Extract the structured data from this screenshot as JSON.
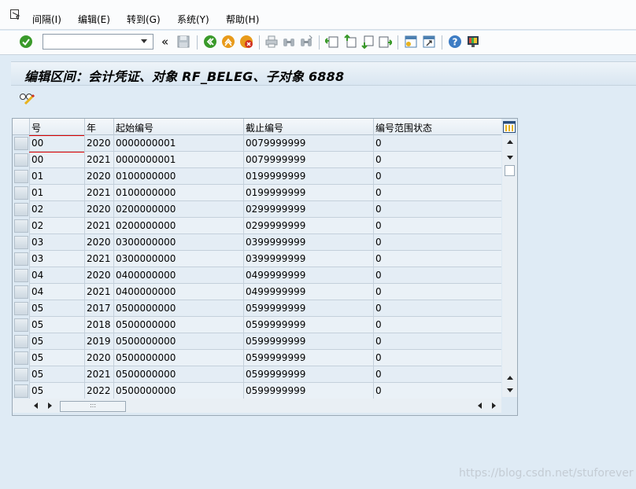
{
  "menu": {
    "items": [
      "间隔(I)",
      "编辑(E)",
      "转到(G)",
      "系统(Y)",
      "帮助(H)"
    ]
  },
  "toolbar": {
    "command_value": "",
    "icons": [
      "enter-check-icon",
      "command-dropdown-icon",
      "collapse-chevron-icon",
      "save-icon",
      "back-icon",
      "exit-icon",
      "cancel-icon",
      "print-icon",
      "find-icon",
      "find-next-icon",
      "first-page-icon",
      "previous-page-icon",
      "next-page-icon",
      "last-page-icon",
      "create-session-icon",
      "shortcut-icon",
      "help-icon",
      "customize-layout-icon"
    ],
    "chevron": "«"
  },
  "title": "编辑区间：会计凭证、对象 RF_BELEG、子对象 6888",
  "grid": {
    "headers": [
      "号",
      "年",
      "起始编号",
      "截止编号",
      "编号范围状态"
    ],
    "rows": [
      [
        "00",
        "2020",
        "0000000001",
        "0079999999",
        "0"
      ],
      [
        "00",
        "2021",
        "0000000001",
        "0079999999",
        "0"
      ],
      [
        "01",
        "2020",
        "0100000000",
        "0199999999",
        "0"
      ],
      [
        "01",
        "2021",
        "0100000000",
        "0199999999",
        "0"
      ],
      [
        "02",
        "2020",
        "0200000000",
        "0299999999",
        "0"
      ],
      [
        "02",
        "2021",
        "0200000000",
        "0299999999",
        "0"
      ],
      [
        "03",
        "2020",
        "0300000000",
        "0399999999",
        "0"
      ],
      [
        "03",
        "2021",
        "0300000000",
        "0399999999",
        "0"
      ],
      [
        "04",
        "2020",
        "0400000000",
        "0499999999",
        "0"
      ],
      [
        "04",
        "2021",
        "0400000000",
        "0499999999",
        "0"
      ],
      [
        "05",
        "2017",
        "0500000000",
        "0599999999",
        "0"
      ],
      [
        "05",
        "2018",
        "0500000000",
        "0599999999",
        "0"
      ],
      [
        "05",
        "2019",
        "0500000000",
        "0599999999",
        "0"
      ],
      [
        "05",
        "2020",
        "0500000000",
        "0599999999",
        "0"
      ],
      [
        "05",
        "2021",
        "0500000000",
        "0599999999",
        "0"
      ],
      [
        "05",
        "2022",
        "0500000000",
        "0599999999",
        "0"
      ]
    ],
    "hscroll_grip": ":::"
  },
  "watermark": "https://blog.csdn.net/stuforever",
  "colors": {
    "background": "#dfebf5",
    "accent_green": "#3a9a2a",
    "accent_orange": "#e89a1a",
    "accent_red": "#d03020"
  }
}
